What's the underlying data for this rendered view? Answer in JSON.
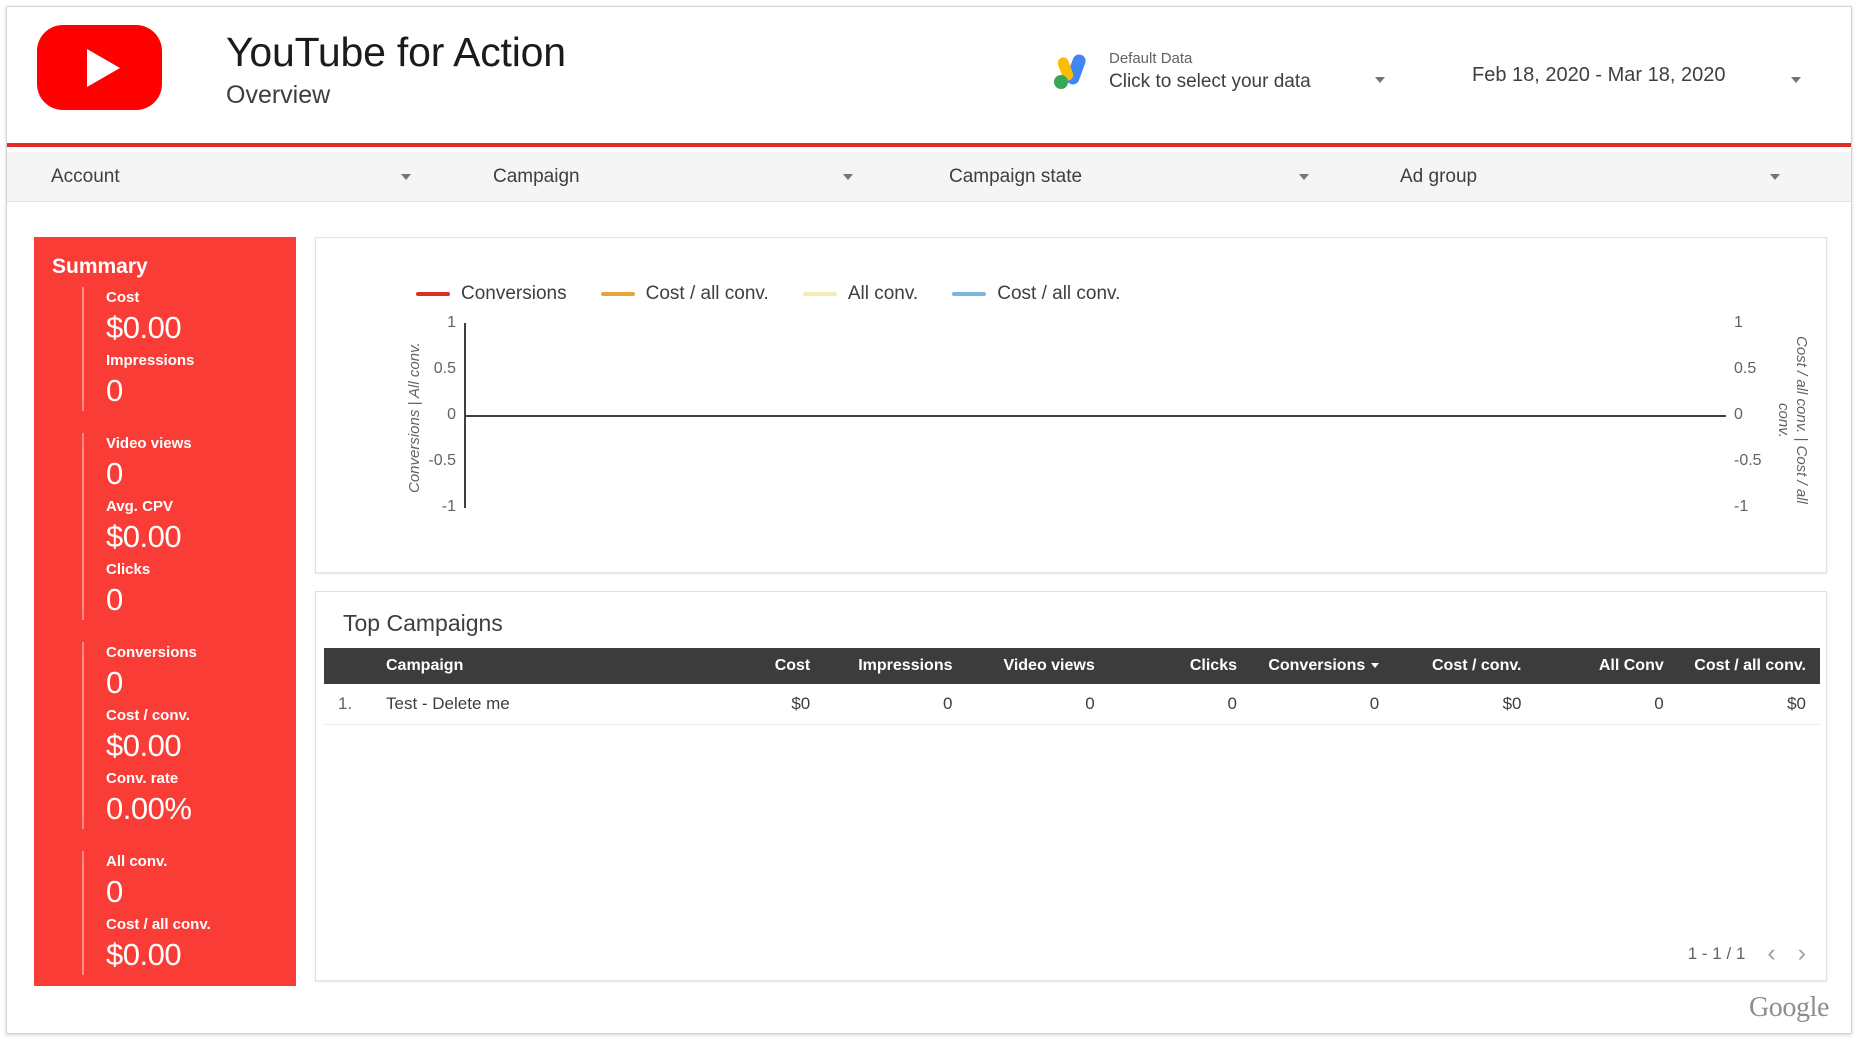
{
  "header": {
    "logo_icon": "youtube-play-icon",
    "title": "YouTube for Action",
    "subtitle": "Overview",
    "data_source": {
      "icon": "google-ads-icon",
      "line1": "Default Data",
      "line2": "Click to select your data"
    },
    "date_range": "Feb 18, 2020 - Mar 18, 2020",
    "accent_color": "#e02c26"
  },
  "filters": [
    {
      "label": "Account"
    },
    {
      "label": "Campaign"
    },
    {
      "label": "Campaign state"
    },
    {
      "label": "Ad group"
    }
  ],
  "summary": {
    "title": "Summary",
    "bg_color": "#fa3c37",
    "groups": [
      {
        "metrics": [
          {
            "label": "Cost",
            "value": "$0.00"
          },
          {
            "label": "Impressions",
            "value": "0"
          }
        ]
      },
      {
        "metrics": [
          {
            "label": "Video views",
            "value": "0"
          },
          {
            "label": "Avg. CPV",
            "value": "$0.00"
          },
          {
            "label": "Clicks",
            "value": "0"
          }
        ]
      },
      {
        "metrics": [
          {
            "label": "Conversions",
            "value": "0"
          },
          {
            "label": "Cost / conv.",
            "value": "$0.00"
          },
          {
            "label": "Conv. rate",
            "value": "0.00%"
          }
        ]
      },
      {
        "metrics": [
          {
            "label": "All conv.",
            "value": "0"
          },
          {
            "label": "Cost / all conv.",
            "value": "$0.00"
          }
        ]
      }
    ]
  },
  "chart_data": {
    "type": "line",
    "title": "",
    "xlabel": "",
    "ylabel": "Conversions | All conv.",
    "y2label": "Cost / all conv. | Cost / all conv.",
    "ylim": [
      -1,
      1
    ],
    "y2lim": [
      -1,
      1
    ],
    "yticks": [
      "1",
      "0.5",
      "0",
      "-0.5",
      "-1"
    ],
    "y2ticks": [
      "1",
      "0.5",
      "0",
      "-0.5",
      "-1"
    ],
    "grid": false,
    "legend_position": "top",
    "x": [],
    "series": [
      {
        "name": "Conversions",
        "color": "#d93025",
        "values": []
      },
      {
        "name": "Cost / all conv.",
        "color": "#e8a33d",
        "values": []
      },
      {
        "name": "All conv.",
        "color": "#f4ecb3",
        "values": []
      },
      {
        "name": "Cost / all conv.",
        "color": "#7cb5de",
        "values": []
      }
    ]
  },
  "table": {
    "title": "Top Campaigns",
    "columns": [
      {
        "key": "idx",
        "label": ""
      },
      {
        "key": "campaign",
        "label": "Campaign"
      },
      {
        "key": "cost",
        "label": "Cost"
      },
      {
        "key": "impressions",
        "label": "Impressions"
      },
      {
        "key": "video_views",
        "label": "Video views"
      },
      {
        "key": "clicks",
        "label": "Clicks"
      },
      {
        "key": "conversions",
        "label": "Conversions",
        "sorted": true
      },
      {
        "key": "cost_conv",
        "label": "Cost / conv."
      },
      {
        "key": "all_conv",
        "label": "All Conv"
      },
      {
        "key": "cost_all_conv",
        "label": "Cost / all conv."
      }
    ],
    "rows": [
      {
        "idx": "1.",
        "campaign": "Test - Delete me",
        "cost": "$0",
        "impressions": "0",
        "video_views": "0",
        "clicks": "0",
        "conversions": "0",
        "cost_conv": "$0",
        "all_conv": "0",
        "cost_all_conv": "$0"
      }
    ],
    "pagination": {
      "count": "1 - 1 / 1",
      "prev_icon": "chevron-left-icon",
      "next_icon": "chevron-right-icon"
    }
  },
  "footer": {
    "brand": "Google"
  }
}
